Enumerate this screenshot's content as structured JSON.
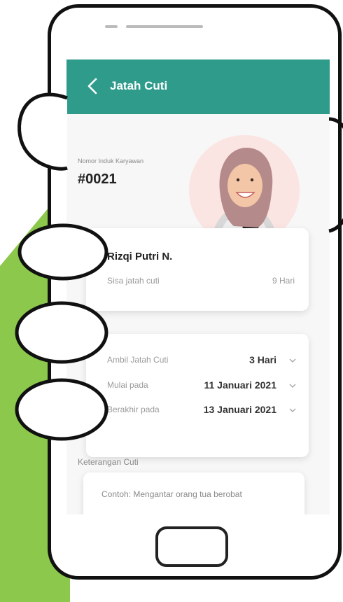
{
  "app": {
    "title": "Jatah Cuti"
  },
  "employee": {
    "nik_label": "Nomor Induk Karyawan",
    "nik_value": "#0021",
    "name": "Rizqi Putri N.",
    "remaining_label": "Sisa jatah cuti",
    "remaining_value": "9 Hari"
  },
  "leave_form": {
    "take_label": "Ambil Jatah Cuti",
    "take_value": "3 Hari",
    "start_label": "Mulai pada",
    "start_value": "11 Januari 2021",
    "end_label": "Berakhir pada",
    "end_value": "13 Januari 2021"
  },
  "notes": {
    "label": "Keterangan Cuti",
    "placeholder": "Contoh: Mengantar orang tua berobat"
  },
  "colors": {
    "appbar": "#2e9b8b",
    "accent_green": "#8cc84b"
  },
  "icons": {
    "back": "chevron-left-icon",
    "dropdown": "chevron-down-icon"
  }
}
